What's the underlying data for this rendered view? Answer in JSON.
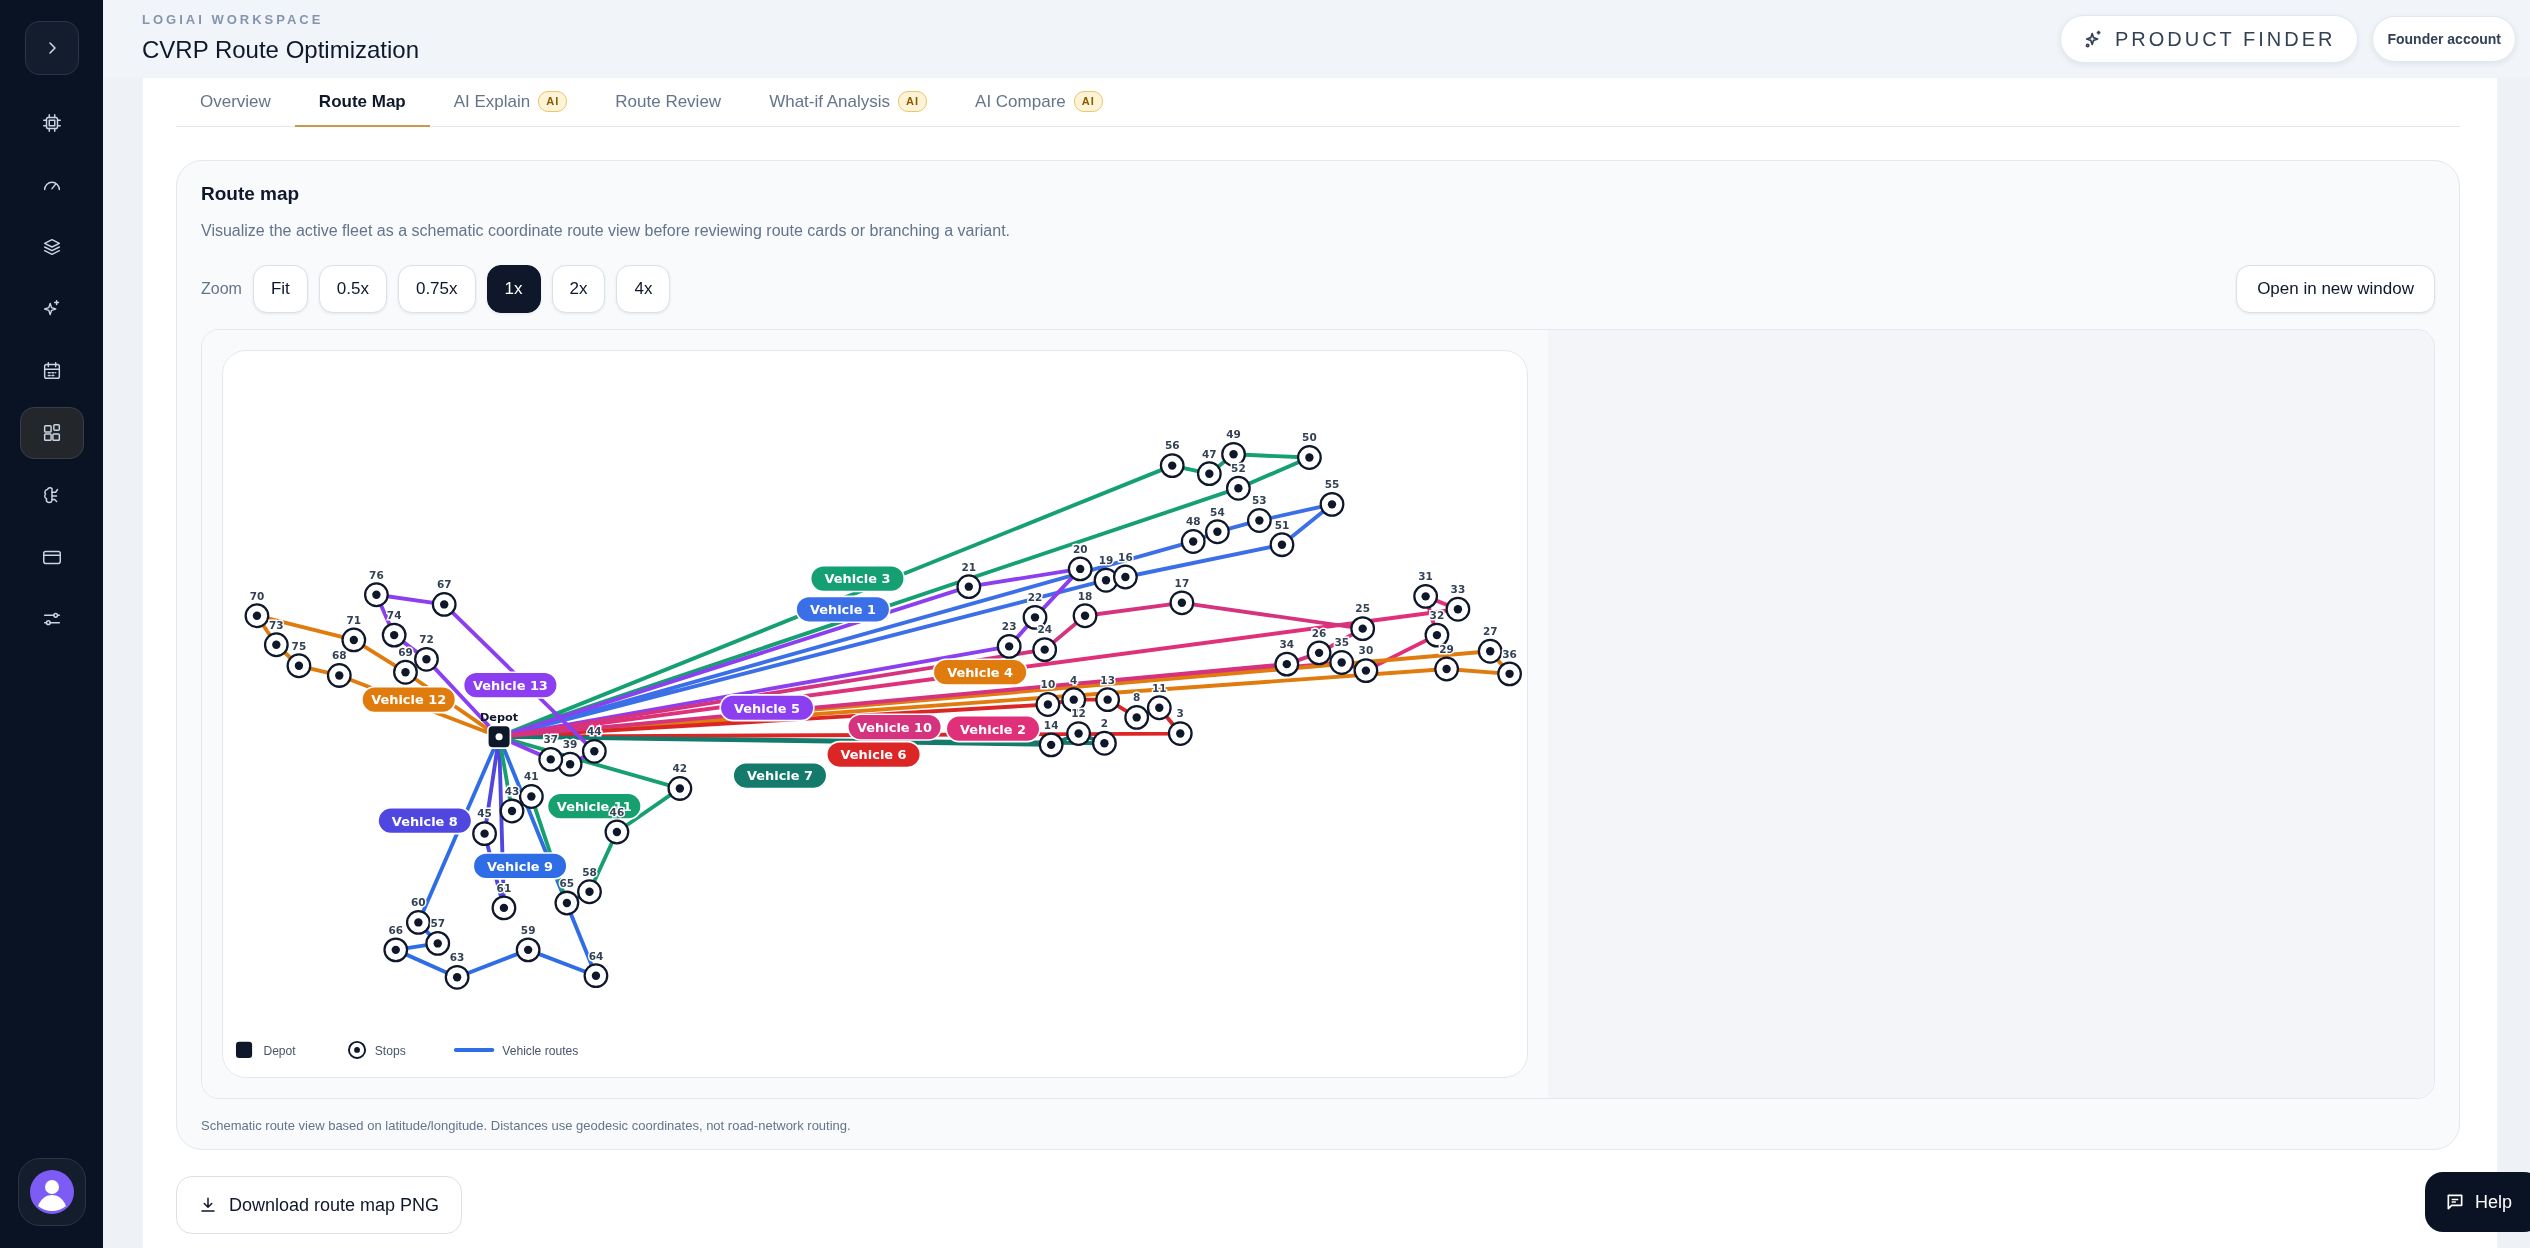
{
  "sidebar": {
    "items": [
      {
        "selected": false
      },
      {
        "selected": false
      },
      {
        "selected": false
      },
      {
        "selected": false
      },
      {
        "selected": false
      },
      {
        "selected": true
      },
      {
        "selected": false
      },
      {
        "selected": false
      },
      {
        "selected": false
      }
    ]
  },
  "header": {
    "workspace": "LOGIAI WORKSPACE",
    "title": "CVRP Route Optimization",
    "product_finder": "PRODUCT FINDER",
    "account": "Founder account"
  },
  "tabs": [
    {
      "label": "Overview",
      "selected": false
    },
    {
      "label": "Route Map",
      "selected": true
    },
    {
      "label": "AI Explain",
      "badge": "AI",
      "selected": false
    },
    {
      "label": "Route Review",
      "selected": false
    },
    {
      "label": "What-if Analysis",
      "badge": "AI",
      "selected": false
    },
    {
      "label": "AI Compare",
      "badge": "AI",
      "selected": false
    }
  ],
  "route_map": {
    "title": "Route map",
    "description": "Visualize the active fleet as a schematic coordinate route view before reviewing route cards or branching a variant.",
    "zoom_label": "Zoom",
    "zoom_options": [
      {
        "label": "Fit",
        "selected": false
      },
      {
        "label": "0.5x",
        "selected": false
      },
      {
        "label": "0.75x",
        "selected": false
      },
      {
        "label": "1x",
        "selected": true
      },
      {
        "label": "2x",
        "selected": false
      },
      {
        "label": "4x",
        "selected": false
      }
    ],
    "open_button": "Open in new window",
    "depot_label": "Depot",
    "vehicles": [
      {
        "name": "Vehicle 1",
        "color": "#3b6fe8",
        "stops": [
          {
            "label": "19"
          },
          {
            "label": "16"
          },
          {
            "label": "51"
          },
          {
            "label": "55"
          },
          {
            "label": "53"
          },
          {
            "label": "54"
          },
          {
            "label": "48"
          }
        ]
      },
      {
        "name": "Vehicle 2",
        "color": "#e0307a",
        "stops": [
          {
            "label": "35"
          },
          {
            "label": "30"
          },
          {
            "label": "32"
          },
          {
            "label": "31"
          },
          {
            "label": "33"
          }
        ]
      },
      {
        "name": "Vehicle 3",
        "color": "#14a073",
        "stops": [
          {
            "label": "56"
          },
          {
            "label": "47"
          },
          {
            "label": "49"
          },
          {
            "label": "50"
          },
          {
            "label": "52"
          }
        ]
      },
      {
        "name": "Vehicle 4",
        "color": "#e07b0e",
        "stops": [
          {
            "label": "27"
          },
          {
            "label": "36"
          },
          {
            "label": "29"
          }
        ]
      },
      {
        "name": "Vehicle 5",
        "color": "#8b3ff0",
        "stops": [
          {
            "label": "21"
          },
          {
            "label": "20"
          },
          {
            "label": "22"
          },
          {
            "label": "23"
          }
        ]
      },
      {
        "name": "Vehicle 6",
        "color": "#dc2626",
        "stops": [
          {
            "label": "10"
          },
          {
            "label": "4"
          },
          {
            "label": "13"
          },
          {
            "label": "8"
          },
          {
            "label": "11"
          },
          {
            "label": "3"
          }
        ]
      },
      {
        "name": "Vehicle 7",
        "color": "#137a6c",
        "stops": [
          {
            "label": "14"
          },
          {
            "label": "12"
          },
          {
            "label": "2"
          }
        ]
      },
      {
        "name": "Vehicle 8",
        "color": "#5046e0",
        "stops": [
          {
            "label": "45"
          },
          {
            "label": "61"
          }
        ]
      },
      {
        "name": "Vehicle 9",
        "color": "#2f6de6",
        "stops": [
          {
            "label": "60"
          },
          {
            "label": "57"
          },
          {
            "label": "66"
          },
          {
            "label": "63"
          },
          {
            "label": "59"
          },
          {
            "label": "64"
          }
        ]
      },
      {
        "name": "Vehicle 10",
        "color": "#d6337f",
        "stops": [
          {
            "label": "24"
          },
          {
            "label": "18"
          },
          {
            "label": "17"
          },
          {
            "label": "25"
          },
          {
            "label": "26"
          },
          {
            "label": "34"
          }
        ]
      },
      {
        "name": "Vehicle 11",
        "color": "#16a06f",
        "stops": [
          {
            "label": "43"
          },
          {
            "label": "41"
          },
          {
            "label": "65"
          },
          {
            "label": "58"
          },
          {
            "label": "46"
          },
          {
            "label": "42"
          }
        ]
      },
      {
        "name": "Vehicle 12",
        "color": "#e07b0e",
        "stops": [
          {
            "label": "68"
          },
          {
            "label": "75"
          },
          {
            "label": "73"
          },
          {
            "label": "70"
          },
          {
            "label": "71"
          },
          {
            "label": "69"
          }
        ]
      },
      {
        "name": "Vehicle 13",
        "color": "#8b3ff0",
        "stops": [
          {
            "label": "72"
          },
          {
            "label": "74"
          },
          {
            "label": "76"
          },
          {
            "label": "67"
          },
          {
            "label": "44"
          },
          {
            "label": "39"
          },
          {
            "label": "37"
          }
        ]
      }
    ],
    "legend": [
      "Depot",
      "Stops",
      "Vehicle routes"
    ],
    "footnote": "Schematic route view based on latitude/longitude. Distances use geodesic coordinates, not road-network routing."
  },
  "download_button": "Download route map PNG",
  "help_button": "Help"
}
